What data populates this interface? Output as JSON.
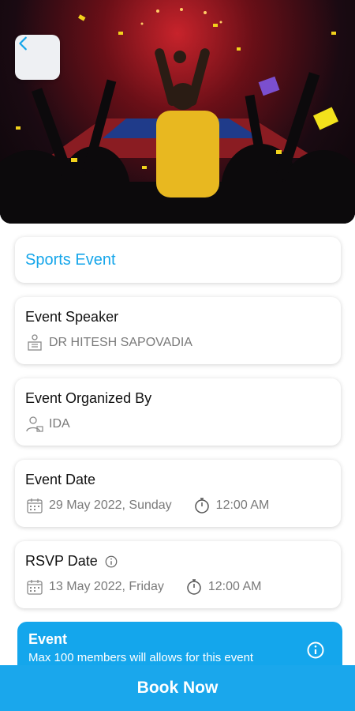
{
  "hero": {
    "image_icon": "stadium-crowd-photo"
  },
  "back_button": {
    "icon": "chevron-left-icon"
  },
  "title": "Sports Event",
  "speaker": {
    "label": "Event Speaker",
    "value": "DR HITESH SAPOVADIA",
    "icon": "speaker-podium-icon"
  },
  "organizer": {
    "label": "Event Organized By",
    "value": "IDA",
    "icon": "organizer-person-icon"
  },
  "event_date": {
    "label": "Event Date",
    "date": "29 May 2022, Sunday",
    "time": "12:00 AM"
  },
  "rsvp_date": {
    "label": "RSVP Date",
    "date": "13 May 2022, Friday",
    "time": "12:00 AM"
  },
  "banner": {
    "title": "Event",
    "subtitle": "Max 100 members will allows for this event"
  },
  "book_button": {
    "label": "Book Now"
  },
  "colors": {
    "accent": "#16a6ea",
    "banner": "#14a6ec",
    "text_muted": "#7a7a7a"
  }
}
